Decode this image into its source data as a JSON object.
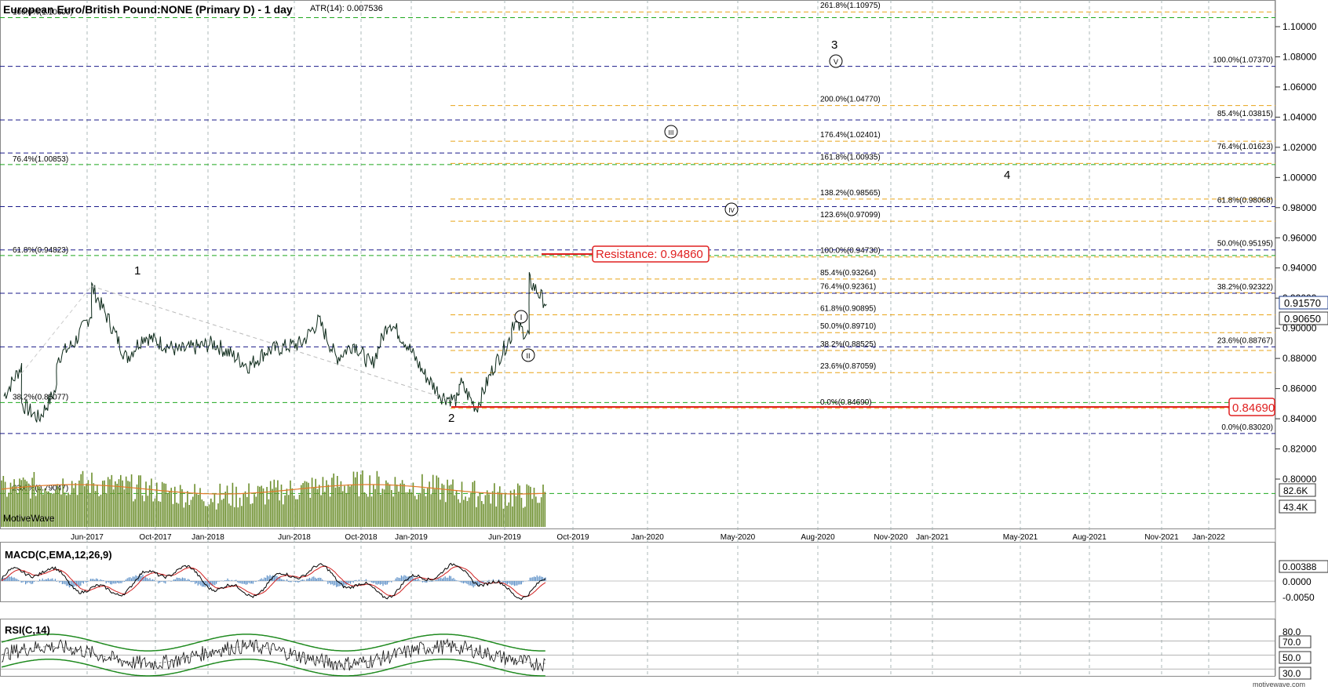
{
  "chart_title": "European Euro/British Pound:NONE (Primary D) - 1 day",
  "atr_label": "ATR(14): 0.007536",
  "watermark": "MotiveWave",
  "footer": "motivewave.com",
  "colors": {
    "price_line": "#0d2a1a",
    "volume_bar": "#6d8f2e",
    "volume_bar_alt": "#3aa888",
    "volume_ma": "#e27a2a",
    "fib_orange": "#e8a317",
    "fib_blue": "#1a1a8a",
    "fib_green": "#1fa81f",
    "resistance_red": "#e02020",
    "macd_line": "#000000",
    "macd_signal": "#d02020",
    "macd_hist": "#5b8fc7",
    "rsi_band": "#1f8a1f"
  },
  "price_axis": {
    "ticks": [
      "1.10000",
      "1.08000",
      "1.06000",
      "1.04000",
      "1.02000",
      "1.00000",
      "0.98000",
      "0.96000",
      "0.94000",
      "0.92000",
      "0.90000",
      "0.88000",
      "0.86000",
      "0.84000",
      "0.82000",
      "0.80000"
    ],
    "last_price": "0.91570",
    "second_price": "0.90650",
    "support_tag": "0.84690"
  },
  "volume_axis": {
    "tag1": "82.6K",
    "tag2": "43.4K"
  },
  "time_axis": [
    "Jun-2017",
    "Oct-2017",
    "Jan-2018",
    "Jun-2018",
    "Oct-2018",
    "Jan-2019",
    "Jun-2019",
    "Oct-2019",
    "Jan-2020",
    "May-2020",
    "Aug-2020",
    "Nov-2020",
    "Jan-2021",
    "May-2021",
    "Aug-2021",
    "Nov-2021",
    "Jan-2022"
  ],
  "resistance_label": "Resistance: 0.94860",
  "wave_labels": {
    "w1": "1",
    "w2": "2",
    "w3": "3",
    "w4": "4",
    "i": "I",
    "ii": "II",
    "iii": "III",
    "iv": "IV",
    "v": "V"
  },
  "fib_left": [
    {
      "label": "100.0%(1.10600)",
      "price": 1.106
    },
    {
      "label": "76.4%(1.00853)",
      "price": 1.00853
    },
    {
      "label": "61.8%(0.94823)",
      "price": 0.94823
    },
    {
      "label": "38.2%(0.85077)",
      "price": 0.85077
    },
    {
      "label": "23.6%(0.79047)",
      "price": 0.79047
    }
  ],
  "fib_mid": [
    {
      "label": "261.8%(1.10975)",
      "price": 1.10975
    },
    {
      "label": "200.0%(1.04770)",
      "price": 1.0477
    },
    {
      "label": "176.4%(1.02401)",
      "price": 1.02401
    },
    {
      "label": "161.8%(1.00935)",
      "price": 1.00935
    },
    {
      "label": "138.2%(0.98565)",
      "price": 0.98565
    },
    {
      "label": "123.6%(0.97099)",
      "price": 0.97099
    },
    {
      "label": "100.0%(0.94730)",
      "price": 0.9473
    },
    {
      "label": "85.4%(0.93264)",
      "price": 0.93264
    },
    {
      "label": "76.4%(0.92361)",
      "price": 0.92361
    },
    {
      "label": "61.8%(0.90895)",
      "price": 0.90895
    },
    {
      "label": "50.0%(0.89710)",
      "price": 0.8971
    },
    {
      "label": "38.2%(0.88525)",
      "price": 0.88525
    },
    {
      "label": "23.6%(0.87059)",
      "price": 0.87059
    },
    {
      "label": "0.0%(0.84690)",
      "price": 0.8469
    }
  ],
  "fib_right": [
    {
      "label": "100.0%(1.07370)",
      "price": 1.0737
    },
    {
      "label": "85.4%(1.03815)",
      "price": 1.03815
    },
    {
      "label": "76.4%(1.01623)",
      "price": 1.01623
    },
    {
      "label": "61.8%(0.98068)",
      "price": 0.98068
    },
    {
      "label": "50.0%(0.95195)",
      "price": 0.95195
    },
    {
      "label": "38.2%(0.92322)",
      "price": 0.92322
    },
    {
      "label": "23.6%(0.88767)",
      "price": 0.88767
    },
    {
      "label": "0.0%(0.83020)",
      "price": 0.8302
    }
  ],
  "macd": {
    "title": "MACD(C,EMA,12,26,9)",
    "ticks": [
      "0.00388",
      "0.0000",
      "-0.0050"
    ]
  },
  "rsi": {
    "title": "RSI(C,14)",
    "ticks": [
      "80.0",
      "70.0",
      "50.0",
      "30.0"
    ]
  },
  "chart_data": {
    "type": "line",
    "title": "European Euro/British Pound:NONE (Primary D) - 1 day",
    "ylim": [
      0.79,
      1.115
    ],
    "price_path": [
      {
        "x": "Mar-2017",
        "y": 0.855
      },
      {
        "x": "Apr-2017",
        "y": 0.875
      },
      {
        "x": "Apr-2017",
        "y": 0.85
      },
      {
        "x": "May-2017",
        "y": 0.84
      },
      {
        "x": "Jun-2017",
        "y": 0.86
      },
      {
        "x": "Jun-2017",
        "y": 0.88
      },
      {
        "x": "Jul-2017",
        "y": 0.89
      },
      {
        "x": "Aug-2017",
        "y": 0.91
      },
      {
        "x": "Aug-2017",
        "y": 0.928
      },
      {
        "x": "Sep-2017",
        "y": 0.905
      },
      {
        "x": "Oct-2017",
        "y": 0.88
      },
      {
        "x": "Nov-2017",
        "y": 0.895
      },
      {
        "x": "Jan-2018",
        "y": 0.885
      },
      {
        "x": "Mar-2018",
        "y": 0.89
      },
      {
        "x": "May-2018",
        "y": 0.875
      },
      {
        "x": "Jun-2018",
        "y": 0.885
      },
      {
        "x": "Aug-2018",
        "y": 0.89
      },
      {
        "x": "Sep-2018",
        "y": 0.905
      },
      {
        "x": "Oct-2018",
        "y": 0.88
      },
      {
        "x": "Nov-2018",
        "y": 0.89
      },
      {
        "x": "Dec-2018",
        "y": 0.875
      },
      {
        "x": "Jan-2019",
        "y": 0.905
      },
      {
        "x": "Feb-2019",
        "y": 0.89
      },
      {
        "x": "Mar-2019",
        "y": 0.87
      },
      {
        "x": "Apr-2019",
        "y": 0.855
      },
      {
        "x": "May-2019",
        "y": 0.852
      },
      {
        "x": "May-2019",
        "y": 0.865
      },
      {
        "x": "Jun-2019",
        "y": 0.847
      },
      {
        "x": "Jul-2019",
        "y": 0.875
      },
      {
        "x": "Aug-2019",
        "y": 0.895
      },
      {
        "x": "Aug-2019",
        "y": 0.905
      },
      {
        "x": "Sep-2019",
        "y": 0.895
      },
      {
        "x": "Sep-2019",
        "y": 0.932
      },
      {
        "x": "Oct-2019",
        "y": 0.916
      }
    ]
  }
}
